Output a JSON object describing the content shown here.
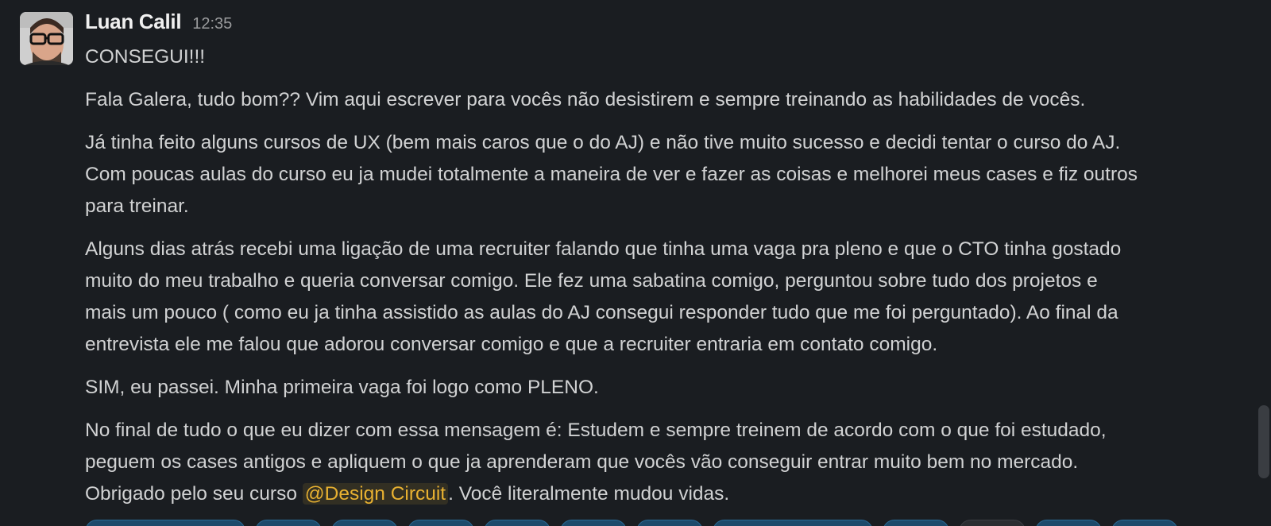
{
  "message": {
    "author": "Luan Calil",
    "timestamp": "12:35",
    "paragraphs": [
      [
        "CONSEGUI!!!"
      ],
      [
        "Fala Galera, tudo bom?? Vim aqui escrever para vocês não desistirem e sempre treinando as habilidades de vocês."
      ],
      [
        "Já tinha feito alguns cursos de UX (bem mais caros que o do AJ) e não tive muito sucesso e decidi tentar o curso do AJ.",
        "Com poucas aulas do curso eu ja mudei totalmente a maneira de ver e fazer as coisas e melhorei meus cases e fiz outros",
        "para treinar."
      ],
      [
        "Alguns dias atrás recebi uma ligação de uma recruiter falando que tinha uma vaga pra pleno e que o CTO tinha gostado",
        "muito do meu trabalho e queria conversar comigo. Ele fez uma sabatina comigo, perguntou sobre tudo dos projetos e",
        "mais um pouco ( como eu ja tinha assistido as aulas do AJ consegui responder tudo que me foi perguntado). Ao final da",
        "entrevista ele me falou que adorou conversar comigo e que a recruiter entraria em contato comigo."
      ],
      [
        "SIM, eu passei. Minha primeira vaga foi logo como PLENO."
      ],
      [
        "No final de tudo o que eu dizer com essa mensagem é: Estudem e sempre treinem de acordo com  o que foi estudado,",
        "peguem os cases antigos e apliquem o que ja aprenderam que vocês vão conseguir entrar muito bem no mercado."
      ]
    ],
    "last_line": {
      "before": "Obrigado pelo seu curso ",
      "mention": "@Design Circuit",
      "after": ". Você literalmente mudou vidas."
    }
  },
  "colors": {
    "background": "#1a1d21",
    "text": "#d1d2d3",
    "mention": "#e8b131",
    "reaction": "#1d4a6b"
  }
}
